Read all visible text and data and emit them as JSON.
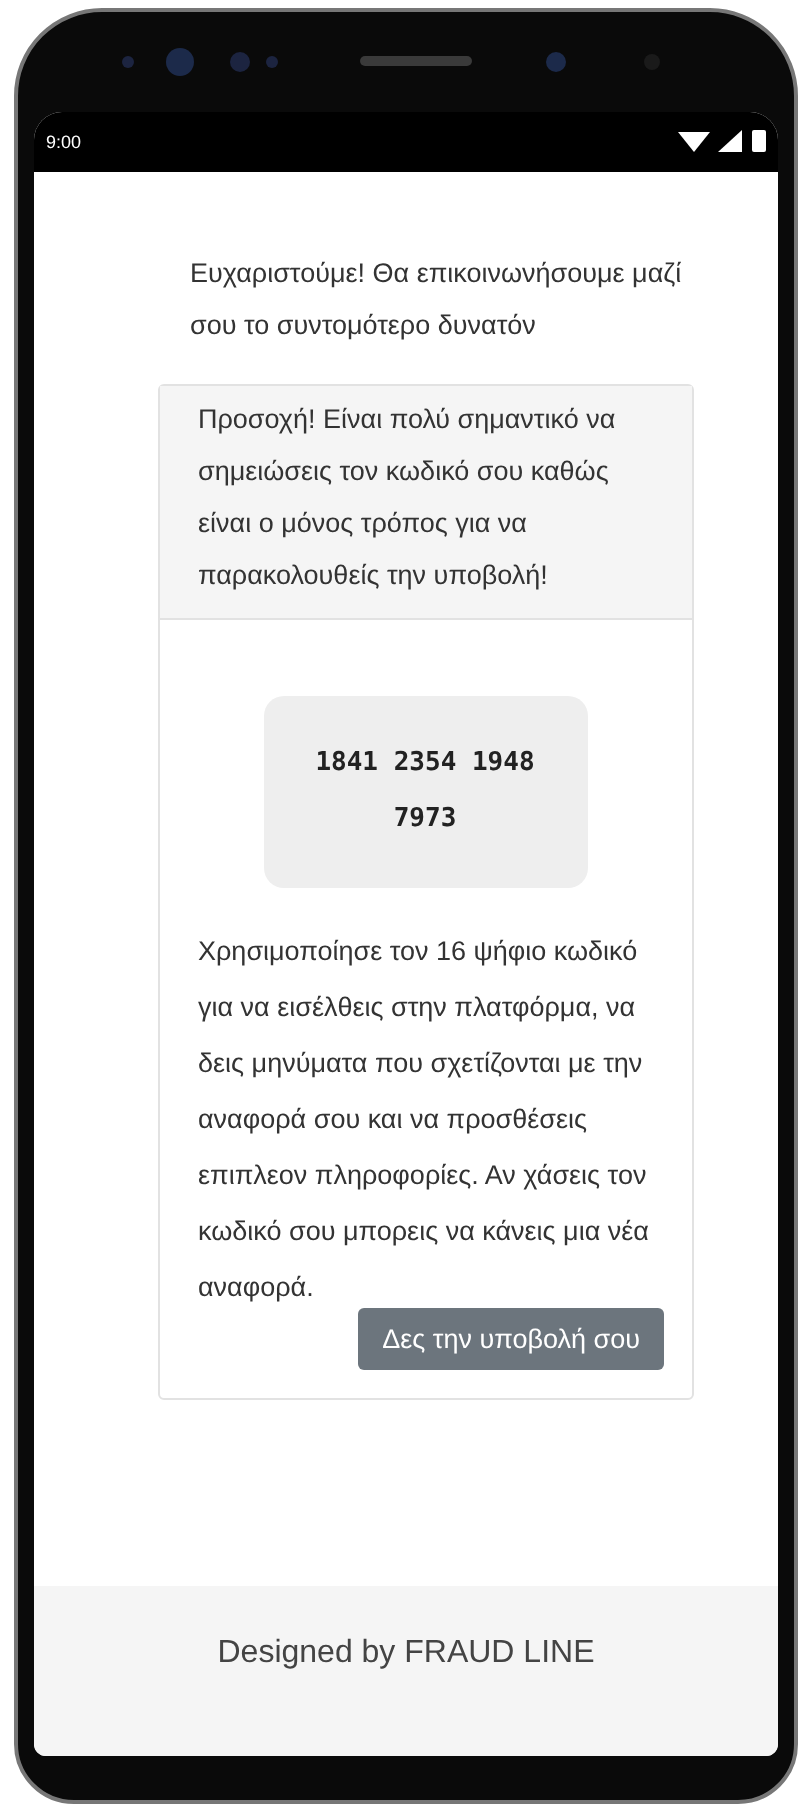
{
  "status_bar": {
    "time": "9:00"
  },
  "message": "Ευχαριστούμε! Θα επικοινωνήσουμε μαζί σου το συντομότερο δυνατόν",
  "card": {
    "header": "Προσοχή! Είναι πολύ σημαντικό να σημειώσεις τον κωδικό σου καθώς είναι ο μόνος τρόπος για να παρακολουθείς την υποβολή!",
    "code": "1841 2354 1948 7973",
    "body": "Χρησιμοποίησε τον 16 ψήφιο κωδικό για να εισέλθεις στην πλατφόρμα, να δεις μηνύματα που σχετίζονται με την αναφορά σου και να προσθέσεις επιπλεον πληροφορίες. Αν χάσεις τον κωδικό σου μπορεις να κάνεις μια νέα αναφορά.",
    "button": "Δες την υποβολή σου"
  },
  "footer": {
    "text": "Designed by FRAUD LINE"
  }
}
